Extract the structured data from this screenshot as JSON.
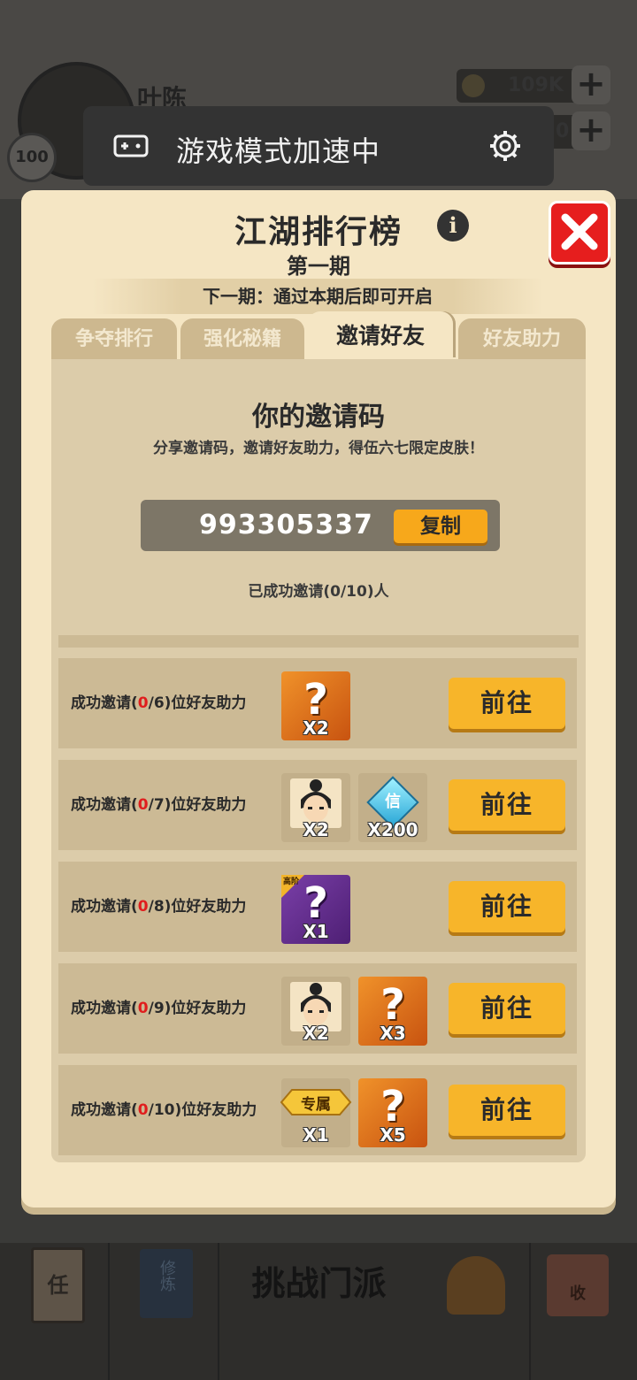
{
  "background": {
    "player_name": "叶陈",
    "level": "100",
    "coins": "109K",
    "second_resource": "0",
    "bottom_nav": {
      "challenge_label": "挑战门派",
      "task_icon_char": "任",
      "book_char": "修炼",
      "shop_char": "收"
    }
  },
  "toast": {
    "title": "游戏模式加速中",
    "icon": "gamepad-icon",
    "settings_icon": "gear-icon"
  },
  "modal": {
    "title": "江湖排行榜",
    "period": "第一期",
    "next_period_notice": "下一期：通过本期后即可开启",
    "tabs": [
      {
        "label": "争夺排行",
        "active": false
      },
      {
        "label": "强化秘籍",
        "active": false
      },
      {
        "label": "邀请好友",
        "active": true
      },
      {
        "label": "好友助力",
        "active": false
      }
    ],
    "invite": {
      "heading": "你的邀请码",
      "description": "分享邀请码，邀请好友助力，得伍六七限定皮肤！",
      "code": "993305337",
      "copy_label": "复制",
      "invited_status": "已成功邀请(0/10)人"
    },
    "tasks": [
      {
        "prefix": "成功邀请(",
        "current": "0",
        "suffix": "/6)位好友助力",
        "button": "前往",
        "rewards": [
          {
            "type": "mystery-outfit",
            "qty": "X2"
          }
        ]
      },
      {
        "prefix": "成功邀请(",
        "current": "0",
        "suffix": "/7)位好友助力",
        "button": "前往",
        "rewards": [
          {
            "type": "character-portrait",
            "qty": "X2"
          },
          {
            "type": "diamond",
            "label": "信",
            "qty": "X200"
          }
        ]
      },
      {
        "prefix": "成功邀请(",
        "current": "0",
        "suffix": "/8)位好友助力",
        "button": "前往",
        "rewards": [
          {
            "type": "advanced-mystery",
            "tag": "高阶",
            "qty": "X1"
          }
        ]
      },
      {
        "prefix": "成功邀请(",
        "current": "0",
        "suffix": "/9)位好友助力",
        "button": "前往",
        "rewards": [
          {
            "type": "character-portrait",
            "qty": "X2"
          },
          {
            "type": "mystery-outfit",
            "qty": "X3"
          }
        ]
      },
      {
        "prefix": "成功邀请(",
        "current": "0",
        "suffix": "/10)位好友助力",
        "button": "前往",
        "rewards": [
          {
            "type": "exclusive-badge",
            "label": "专属",
            "qty": "X1"
          },
          {
            "type": "mystery-outfit",
            "qty": "X5"
          }
        ]
      }
    ]
  },
  "colors": {
    "accent": "#f7b52a",
    "close": "#e61e1e",
    "highlight": "#e01d1d",
    "panel": "#f5e6c4"
  }
}
